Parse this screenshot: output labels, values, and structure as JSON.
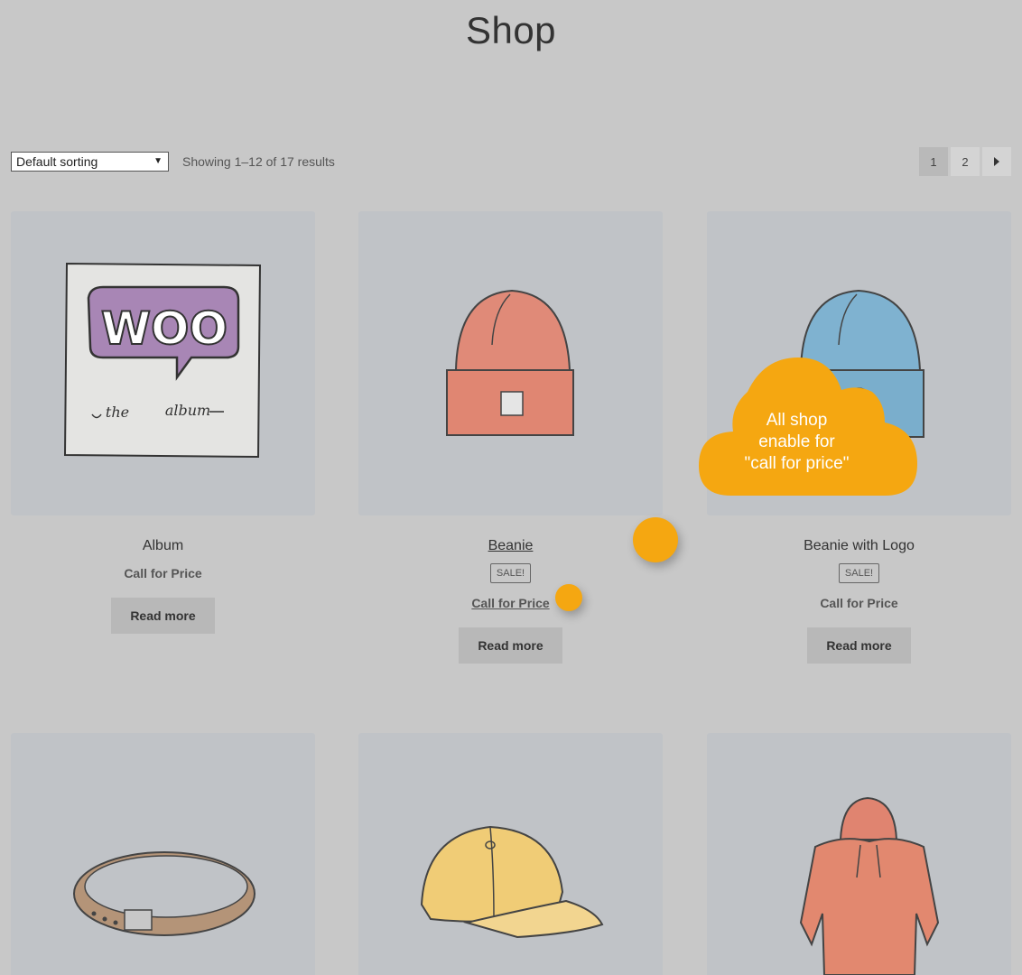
{
  "page": {
    "title": "Shop"
  },
  "toolbar": {
    "sort_selected": "Default sorting",
    "result_count": "Showing 1–12 of 17 results"
  },
  "pagination": {
    "pages": [
      "1",
      "2"
    ],
    "next_icon": "caret-right-icon"
  },
  "products": [
    {
      "name": "Album",
      "price": "Call for Price",
      "button": "Read more",
      "image": "album-icon"
    },
    {
      "name": "Beanie",
      "badge": "SALE!",
      "price": "Call for Price",
      "button": "Read more",
      "image": "beanie-icon"
    },
    {
      "name": "Beanie with Logo",
      "badge": "SALE!",
      "price": "Call for Price",
      "button": "Read more",
      "image": "beanie-logo-icon"
    },
    {
      "image": "belt-icon"
    },
    {
      "image": "cap-icon"
    },
    {
      "image": "hoodie-icon"
    }
  ],
  "callout": {
    "line1": "All shop",
    "line2": "enable for",
    "line3": "\"call for price\"",
    "color": "#f5a711"
  },
  "album_art": {
    "logo": "WOO",
    "subtitle_left": "the",
    "subtitle_right": "album"
  }
}
